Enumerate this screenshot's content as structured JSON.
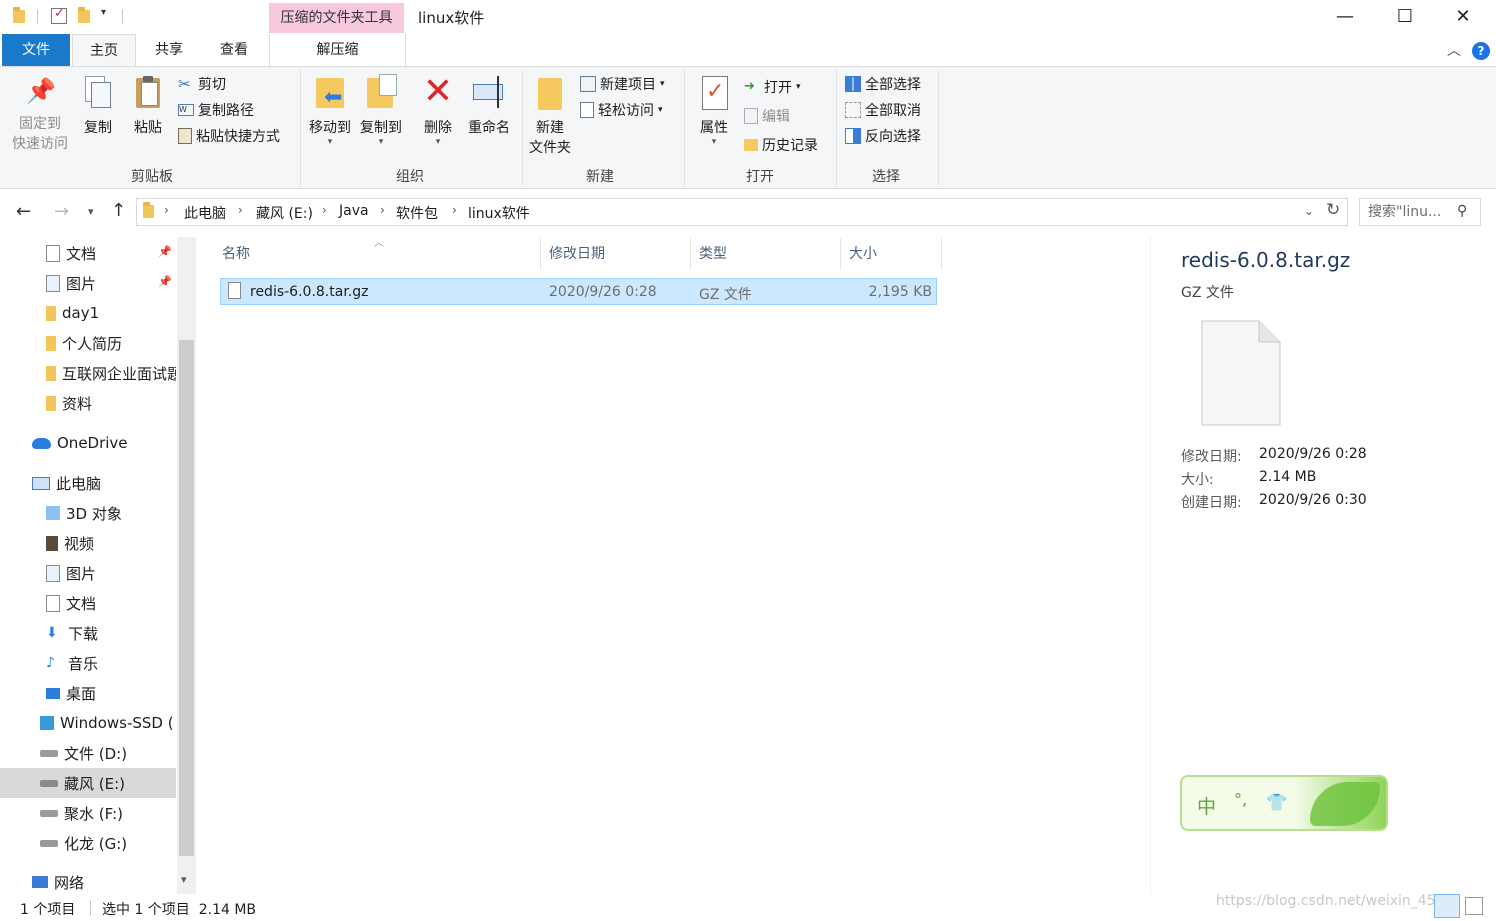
{
  "titlebar": {
    "context_tool": "压缩的文件夹工具",
    "title": "linux软件",
    "minimize": "—",
    "maximize": "☐",
    "close": "✕"
  },
  "tabs": {
    "file": "文件",
    "home": "主页",
    "share": "共享",
    "view": "查看",
    "extract": "解压缩"
  },
  "ribbon": {
    "clipboard": {
      "pin": "固定到\n快速访问",
      "copy": "复制",
      "paste": "粘贴",
      "cut": "剪切",
      "copy_path": "复制路径",
      "paste_shortcut": "粘贴快捷方式",
      "label": "剪贴板"
    },
    "organize": {
      "move_to": "移动到",
      "copy_to": "复制到",
      "delete": "删除",
      "rename": "重命名",
      "label": "组织"
    },
    "new": {
      "new_folder": "新建\n文件夹",
      "new_item": "新建项目",
      "easy_access": "轻松访问",
      "label": "新建"
    },
    "open": {
      "properties": "属性",
      "open": "打开",
      "edit": "编辑",
      "history": "历史记录",
      "label": "打开"
    },
    "select": {
      "select_all": "全部选择",
      "select_none": "全部取消",
      "invert": "反向选择",
      "label": "选择"
    }
  },
  "address": {
    "crumbs": [
      "此电脑",
      "藏风 (E:)",
      "Java",
      "软件包",
      "linux软件"
    ],
    "search_placeholder": "搜索\"linu..."
  },
  "nav": {
    "items": [
      "文档",
      "图片",
      "day1",
      "个人简历",
      "互联网企业面试题",
      "资料",
      "OneDrive",
      "此电脑",
      "3D 对象",
      "视频",
      "图片",
      "文档",
      "下载",
      "音乐",
      "桌面",
      "Windows-SSD (",
      "文件 (D:)",
      "藏风 (E:)",
      "聚水 (F:)",
      "化龙 (G:)",
      "网络"
    ]
  },
  "columns": {
    "name": "名称",
    "modified": "修改日期",
    "type": "类型",
    "size": "大小"
  },
  "files": [
    {
      "name": "redis-6.0.8.tar.gz",
      "modified": "2020/9/26 0:28",
      "type": "GZ 文件",
      "size": "2,195 KB"
    }
  ],
  "details": {
    "filename": "redis-6.0.8.tar.gz",
    "filetype": "GZ 文件",
    "modified_label": "修改日期:",
    "modified_value": "2020/9/26 0:28",
    "size_label": "大小:",
    "size_value": "2.14 MB",
    "created_label": "创建日期:",
    "created_value": "2020/9/26 0:30"
  },
  "ime": {
    "mode": "中",
    "punct": "°,"
  },
  "status": {
    "count": "1 个项目",
    "selected": "选中 1 个项目  2.14 MB"
  },
  "watermark": "https://blog.csdn.net/weixin_45..."
}
